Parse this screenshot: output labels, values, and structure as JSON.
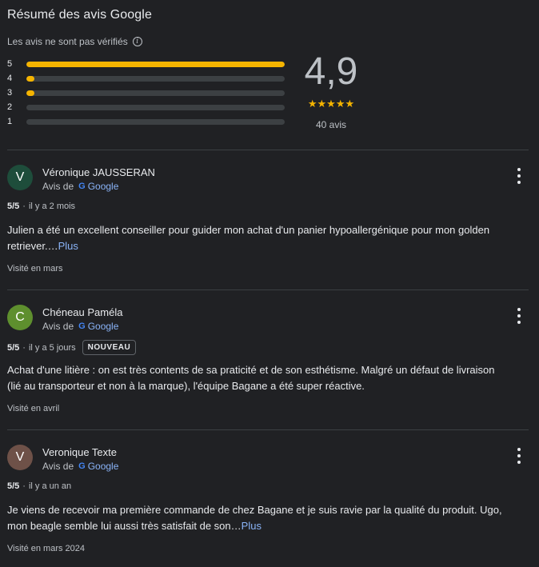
{
  "summary": {
    "title": "Résumé des avis Google",
    "unverified": "Les avis ne sont pas vérifiés",
    "score": "4,9",
    "stars": "★★★★★",
    "count": "40 avis",
    "distribution": [
      {
        "label": "5",
        "fraction": 1.0
      },
      {
        "label": "4",
        "fraction": 0.03
      },
      {
        "label": "3",
        "fraction": 0.03
      },
      {
        "label": "2",
        "fraction": 0.0
      },
      {
        "label": "1",
        "fraction": 0.0
      }
    ],
    "accent_color": "#f5b400"
  },
  "reviews": [
    {
      "initial": "V",
      "avatar_color": "#1e4d3b",
      "name": "Véronique JAUSSERAN",
      "via_prefix": "Avis de",
      "via_source": "Google",
      "rating": "5/5",
      "time": "il y a 2 mois",
      "badge": "",
      "text": "Julien a été un excellent conseiller pour guider mon achat d'un panier hypoallergénique pour mon golden retriever.…",
      "more": "Plus",
      "visited": "Visité en mars"
    },
    {
      "initial": "C",
      "avatar_color": "#5e8f2e",
      "name": "Chéneau Paméla",
      "via_prefix": "Avis de",
      "via_source": "Google",
      "rating": "5/5",
      "time": "il y a 5 jours",
      "badge": "NOUVEAU",
      "text": "Achat d'une litière : on est très contents de sa praticité et de son esthétisme. Malgré un défaut de livraison (lié au transporteur et non à la marque), l'équipe Bagane a été super réactive.",
      "more": "",
      "visited": "Visité en avril"
    },
    {
      "initial": "V",
      "avatar_color": "#6e5148",
      "name": "Veronique Texte",
      "via_prefix": "Avis de",
      "via_source": "Google",
      "rating": "5/5",
      "time": "il y a un an",
      "badge": "",
      "text": "Je viens de recevoir ma première commande de chez Bagane et je suis ravie par la qualité du produit. Ugo, mon beagle semble lui aussi très satisfait de son…",
      "more": "Plus",
      "visited": "Visité en mars 2024"
    }
  ]
}
